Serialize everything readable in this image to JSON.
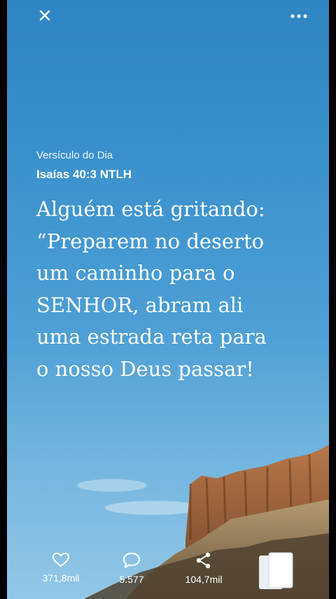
{
  "header": {
    "close_icon": "close-icon",
    "more_icon": "more-options-icon"
  },
  "verse": {
    "caption": "Versículo do Dia",
    "reference": "Isaías 40:3 NTLH",
    "lines": [
      "Alguém está gritando:",
      "“Preparem no deserto",
      "um caminho para o",
      "SENHOR, abram ali",
      "uma estrada reta para",
      "o nosso Deus passar!"
    ]
  },
  "actions": {
    "likes": {
      "icon": "heart-icon",
      "count": "371,8mil"
    },
    "comments": {
      "icon": "comment-icon",
      "count": "5.577"
    },
    "shares": {
      "icon": "share-icon",
      "count": "104,7mil"
    },
    "cards": {
      "icon": "cards-icon"
    }
  },
  "colors": {
    "sky_top": "#2f84c2",
    "sky_bottom": "#94c7e6",
    "rock": "#8a5a36",
    "text": "#ffffff"
  }
}
